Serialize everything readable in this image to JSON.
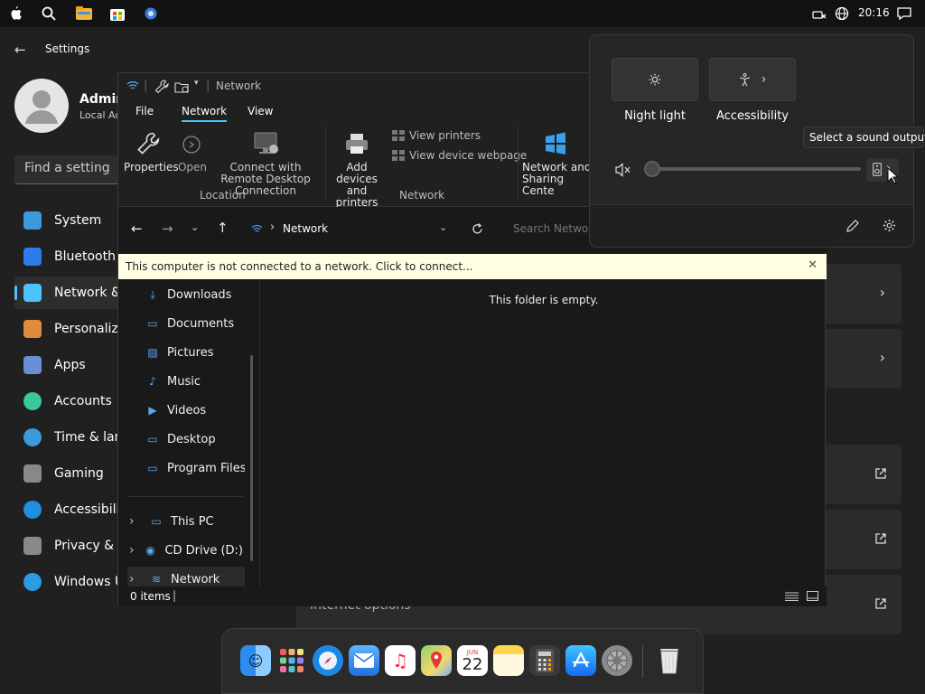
{
  "menubar": {
    "clock": "20:16"
  },
  "settings": {
    "title": "Settings",
    "user_name": "Admin",
    "user_sub": "Local Ac",
    "search_placeholder": "Find a setting",
    "nav": [
      {
        "label": "System",
        "color": "#3a9bdc"
      },
      {
        "label": "Bluetooth &",
        "color": "#2b7de9"
      },
      {
        "label": "Network &",
        "color": "#4cc2ff"
      },
      {
        "label": "Personaliza",
        "color": "#e08a3c"
      },
      {
        "label": "Apps",
        "color": "#6b8fd6"
      },
      {
        "label": "Accounts",
        "color": "#3ac8a0"
      },
      {
        "label": "Time & lang",
        "color": "#3a9bdc"
      },
      {
        "label": "Gaming",
        "color": "#888888"
      },
      {
        "label": "Accessibility",
        "color": "#1f8fe0"
      },
      {
        "label": "Privacy & se",
        "color": "#8a8a8a"
      },
      {
        "label": "Windows U",
        "color": "#2b9be6"
      }
    ],
    "internet_options": "Internet options"
  },
  "explorer": {
    "title_location": "Network",
    "tabs": {
      "file": "File",
      "network": "Network",
      "view": "View"
    },
    "ribbon": {
      "properties": "Properties",
      "open": "Open",
      "connect_remote": "Connect with Remote Desktop Connection",
      "location_group": "Location",
      "add_devices": "Add devices and printers",
      "view_printers": "View printers",
      "view_device_webpage": "View device webpage",
      "network_group": "Network",
      "network_sharing": "Network and Sharing Cente"
    },
    "address": "Network",
    "search_placeholder": "Search Network",
    "infobar": "This computer is not connected to a network. Click to connect...",
    "empty_message": "This folder is empty.",
    "tree": [
      {
        "label": "Downloads",
        "pinned": true
      },
      {
        "label": "Documents",
        "pinned": true
      },
      {
        "label": "Pictures",
        "pinned": true
      },
      {
        "label": "Music",
        "pinned": true
      },
      {
        "label": "Videos",
        "pinned": true
      },
      {
        "label": "Desktop",
        "pinned": false
      },
      {
        "label": "Program Files",
        "pinned": false
      }
    ],
    "tree_bottom": [
      {
        "label": "This PC"
      },
      {
        "label": "CD Drive (D:) Ve"
      },
      {
        "label": "Network"
      }
    ],
    "status": "0 items"
  },
  "quick_settings": {
    "night_light": "Night light",
    "accessibility": "Accessibility",
    "tooltip": "Select a sound output",
    "volume_level": 0
  },
  "dock": {
    "calendar_month": "JUN",
    "calendar_day": "22"
  }
}
